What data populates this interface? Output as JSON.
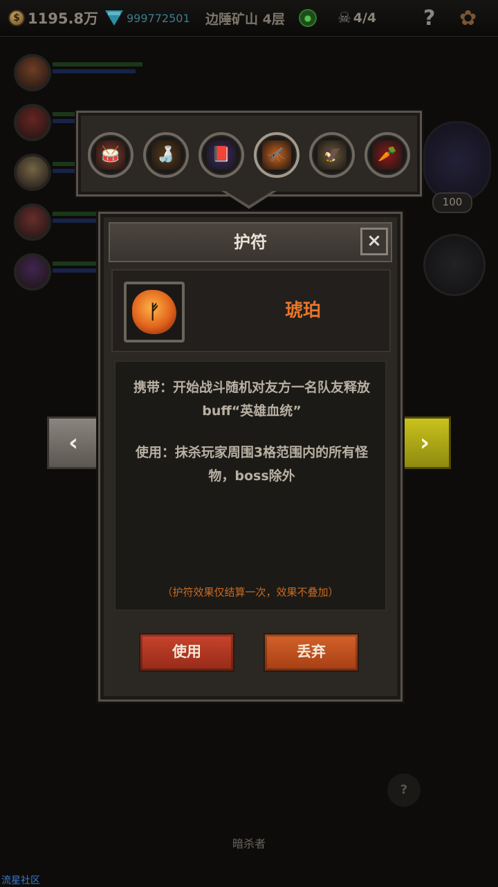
{
  "hud": {
    "gold": "1195.8万",
    "gems": "999772501",
    "floor": "边陲矿山 4层",
    "kills": "4/4",
    "help": "?"
  },
  "heroes": [
    {
      "name": "hero-1",
      "color": "#c0673a"
    },
    {
      "name": "hero-2",
      "color": "#b03a35"
    },
    {
      "name": "hero-3",
      "color": "#c9b07a"
    },
    {
      "name": "hero-4",
      "color": "#b04a48"
    },
    {
      "name": "hero-5",
      "color": "#6a3a8a"
    }
  ],
  "side": {
    "angel_count": "100",
    "hint": "?",
    "enemy_label": "暗杀者"
  },
  "charms": [
    {
      "icon": "drum-icon",
      "glyph": "🥁"
    },
    {
      "icon": "gourd-icon",
      "glyph": "🍶"
    },
    {
      "icon": "book-icon",
      "glyph": "📕"
    },
    {
      "icon": "amber-icon",
      "glyph": "🦟",
      "active": true
    },
    {
      "icon": "griffin-icon",
      "glyph": "🦅"
    },
    {
      "icon": "arrow-charm-icon",
      "glyph": "🥕"
    }
  ],
  "dialog": {
    "title": "护符",
    "close": "×",
    "item_name": "琥珀",
    "desc_carry": "携带：开始战斗随机对友方一名队友释放buff“英雄血统”",
    "desc_use": "使用：抹杀玩家周围3格范围内的所有怪物，boss除外",
    "note": "（护符效果仅结算一次，效果不叠加）",
    "use_label": "使用",
    "discard_label": "丢弃"
  },
  "nav": {
    "prev": "‹",
    "next": "›"
  },
  "watermark": "流星社区",
  "colors": {
    "accent_orange": "#e6762a",
    "use_button": "#c8442c",
    "next_arrow": "#c9c21c"
  }
}
